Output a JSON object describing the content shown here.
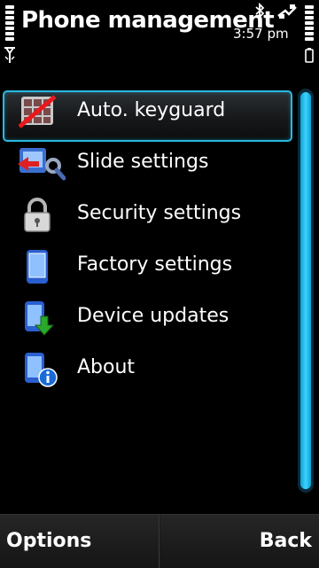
{
  "status_bar": {
    "title": "Phone management",
    "time": "3:57 pm"
  },
  "menu": {
    "items": [
      {
        "label": "Auto. keyguard",
        "icon": "keyguard-icon",
        "selected": true
      },
      {
        "label": "Slide settings",
        "icon": "slide-settings-icon",
        "selected": false
      },
      {
        "label": "Security settings",
        "icon": "lock-icon",
        "selected": false
      },
      {
        "label": "Factory settings",
        "icon": "phone-icon",
        "selected": false
      },
      {
        "label": "Device updates",
        "icon": "download-phone-icon",
        "selected": false
      },
      {
        "label": "About",
        "icon": "info-phone-icon",
        "selected": false
      }
    ]
  },
  "softkeys": {
    "left": "Options",
    "right": "Back"
  },
  "colors": {
    "accent": "#2ab8e0",
    "scrollbar": "#1ab8f0",
    "background": "#000000"
  }
}
